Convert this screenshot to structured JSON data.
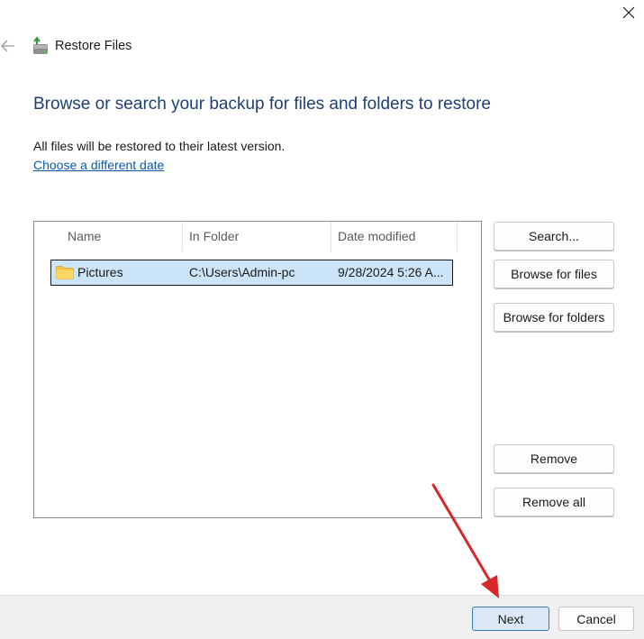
{
  "window": {
    "title": "Restore Files",
    "close_icon": "close-icon",
    "back_icon": "back-arrow-icon",
    "app_icon": "restore-files-icon"
  },
  "main": {
    "heading": "Browse or search your backup for files and folders to restore",
    "subtext": "All files will be restored to their latest version.",
    "date_link": "Choose a different date"
  },
  "file_list": {
    "columns": [
      "Name",
      "In Folder",
      "Date modified"
    ],
    "rows": [
      {
        "icon": "folder-icon",
        "name": "Pictures",
        "folder": "C:\\Users\\Admin-pc",
        "date": "9/28/2024 5:26 A..."
      }
    ]
  },
  "side_buttons": {
    "search": "Search...",
    "browse_files": "Browse for files",
    "browse_folders": "Browse for folders",
    "remove": "Remove",
    "remove_all": "Remove all"
  },
  "footer": {
    "next": "Next",
    "cancel": "Cancel"
  },
  "colors": {
    "heading": "#1e3f73",
    "link": "#0b5aa8",
    "selection": "#cce4f7",
    "annotation_arrow": "#d9262a"
  }
}
